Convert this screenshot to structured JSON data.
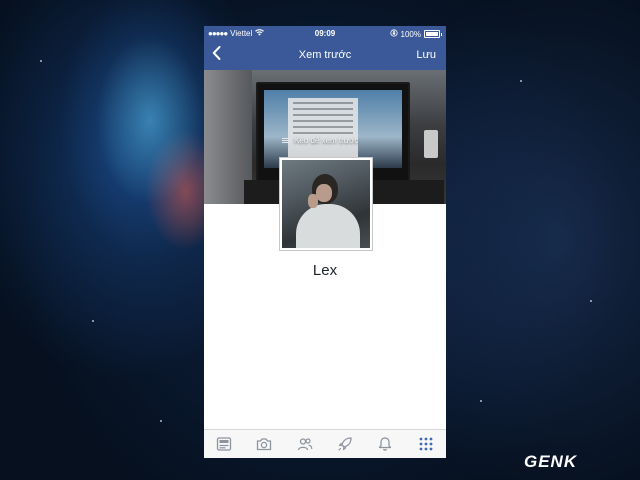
{
  "status_bar": {
    "signal": "●●●●●",
    "carrier": "Viettel",
    "wifi_icon": "wifi-icon",
    "time": "09:09",
    "lock_icon": "rotation-lock-icon",
    "battery": "100%"
  },
  "navbar": {
    "back_icon": "chevron-left-icon",
    "title": "Xem trước",
    "save_label": "Lưu"
  },
  "cover": {
    "drag_hint": "Kéo để xem trước"
  },
  "profile": {
    "name": "Lex"
  },
  "tab_bar": {
    "tabs": [
      {
        "icon": "news-feed-icon"
      },
      {
        "icon": "camera-icon"
      },
      {
        "icon": "friends-icon"
      },
      {
        "icon": "rocket-icon"
      },
      {
        "icon": "bell-icon"
      },
      {
        "icon": "menu-grid-icon",
        "active": true
      }
    ],
    "accent": "#4267b2"
  },
  "theme": {
    "brand": "#3b5998"
  },
  "watermark": {
    "text": "GENK"
  }
}
